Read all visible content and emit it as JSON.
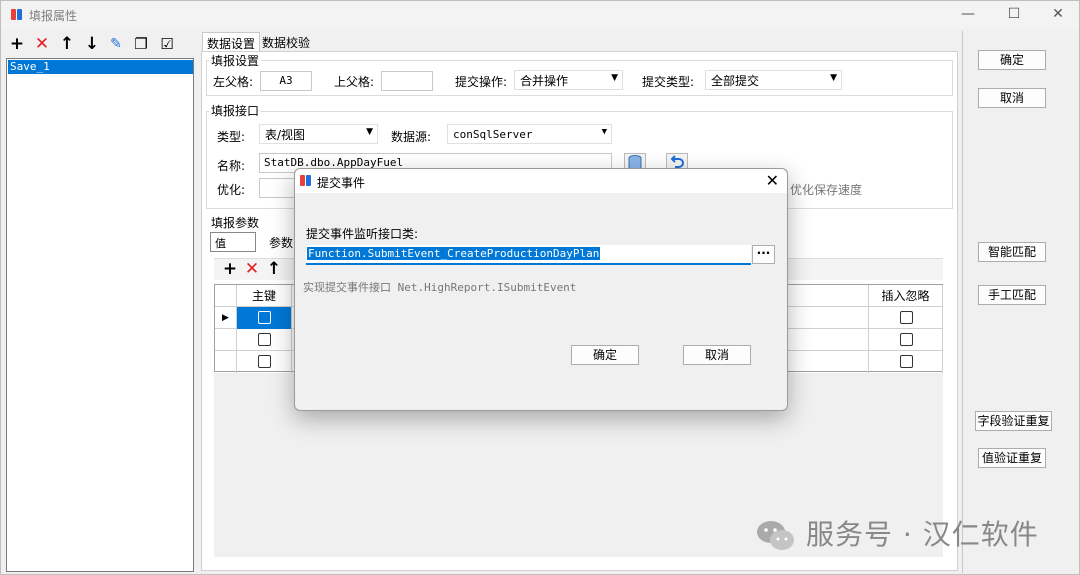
{
  "window": {
    "title": "填报属性",
    "min": "—",
    "max": "☐",
    "close": "✕"
  },
  "left": {
    "toolbar_icons": [
      "+",
      "✕",
      "↑",
      "↓",
      "✎",
      "❐",
      "☑"
    ],
    "items": [
      "Save_1"
    ]
  },
  "tabs": [
    "数据设置",
    "数据校验"
  ],
  "fill_settings": {
    "group": "填报设置",
    "left_parent_label": "左父格:",
    "left_parent_value": "A3",
    "up_parent_label": "上父格:",
    "up_parent_value": "",
    "submit_op_label": "提交操作:",
    "submit_op_value": "合并操作",
    "submit_type_label": "提交类型:",
    "submit_type_value": "全部提交"
  },
  "fill_interface": {
    "group": "填报接口",
    "type_label": "类型:",
    "type_value": "表/视图",
    "datasource_label": "数据源:",
    "datasource_value": "conSqlServer",
    "name_label": "名称:",
    "name_value": "StatDB.dbo.AppDayFuel",
    "optimize_label": "优化:",
    "optimize_hint": "优化保存速度"
  },
  "fill_params": {
    "group": "填报参数",
    "tab1": "值",
    "tab2": "参数",
    "toolbar_icons": [
      "+",
      "✕",
      "↑"
    ],
    "col_key": "主键",
    "col_ignore": "插入忽略",
    "rows": [
      {
        "key": true,
        "ignore": false
      },
      {
        "key": false,
        "ignore": false
      },
      {
        "key": false,
        "ignore": false
      }
    ]
  },
  "right": {
    "ok": "确定",
    "cancel": "取消",
    "smart_match": "智能匹配",
    "manual_match": "手工匹配",
    "field_dup": "字段验证重复",
    "value_dup": "值验证重复"
  },
  "dialog": {
    "title": "提交事件",
    "listener_label": "提交事件监听接口类:",
    "listener_value": "Function.SubmitEvent_CreateProductionDayPlan",
    "browse": "···",
    "hint": "实现提交事件接口 Net.HighReport.ISubmitEvent",
    "ok": "确定",
    "cancel": "取消"
  },
  "watermark": "服务号 · 汉仁软件",
  "colors": {
    "accent": "#0078d7",
    "logo_red": "#e8413c",
    "logo_blue": "#1e6fd9"
  }
}
